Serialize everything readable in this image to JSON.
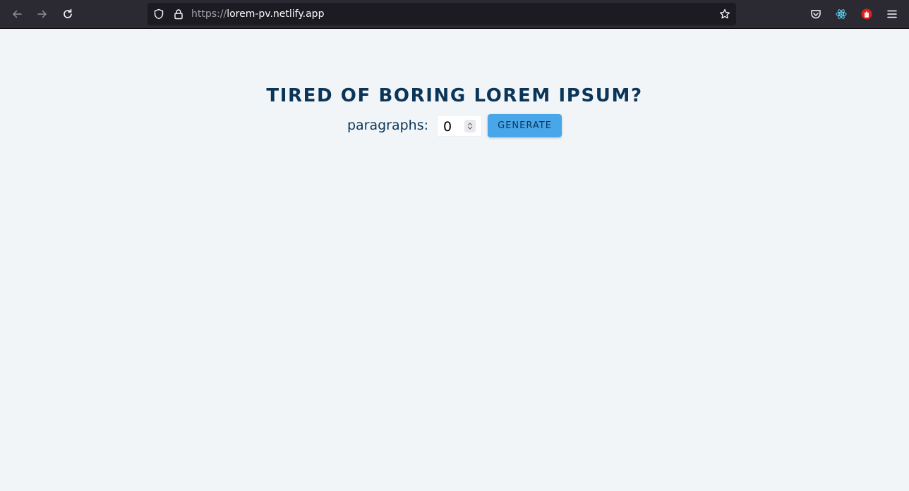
{
  "browser": {
    "url_scheme": "https://",
    "url_host": "lorem-pv.netlify.app",
    "icons": {
      "back": "arrow-left-icon",
      "forward": "arrow-right-icon",
      "reload": "reload-icon",
      "shield": "shield-icon",
      "lock": "lock-icon",
      "bookmark": "star-icon",
      "pocket": "pocket-icon",
      "react_devtools": "react-icon",
      "ublock": "hand-stop-icon",
      "menu": "hamburger-menu-icon"
    }
  },
  "page": {
    "title": "TIRED OF BORING LOREM IPSUM?",
    "paragraphs_label": "paragraphs:",
    "paragraphs_value": "0",
    "generate_label": "GENERATE"
  },
  "colors": {
    "background": "#f1f5f8",
    "heading": "#0b3558",
    "button": "#49a6e9",
    "toolbar": "#2b2a33"
  }
}
